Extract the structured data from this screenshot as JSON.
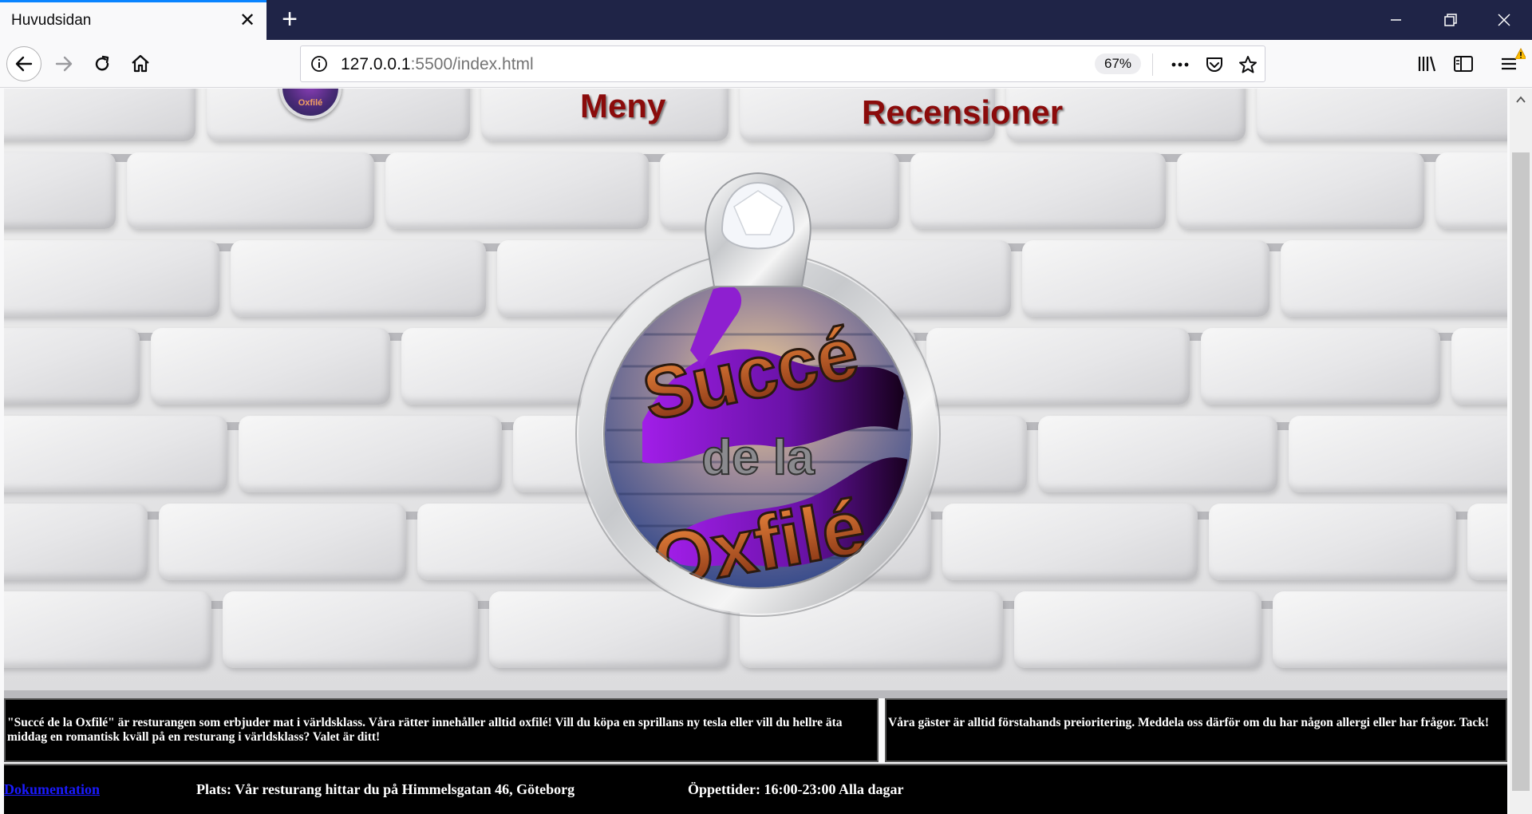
{
  "browser": {
    "tab_title": "Huvudsidan",
    "url_host": "127.0.0.1",
    "url_rest": ":5500/index.html",
    "zoom": "67%"
  },
  "site": {
    "logo_small_text": "Oxfilé",
    "nav": {
      "meny": "Meny",
      "recensioner": "Recensioner"
    },
    "logo_main": {
      "line1": "Succé",
      "line2": "de la",
      "line3": "Oxfilé"
    },
    "info_left": "\"Succé de la Oxfilé\" är resturangen som erbjuder mat i världsklass. Våra rätter innehåller alltid oxfilé! Vill du köpa en sprillans ny tesla eller vill du hellre äta middag en romantisk kväll på en resturang i världsklass? Valet är ditt!",
    "info_right": "Våra gäster är alltid förstahands preioritering. Meddela oss därför om du har någon allergi eller har frågor. Tack!",
    "footer": {
      "doc_link": "Dokumentation",
      "plats": "Plats: Vår resturang hittar du på Himmelsgatan 46, Göteborg",
      "tider": "Öppettider: 16:00-23:00 Alla dagar"
    }
  },
  "colors": {
    "tabstrip": "#1f2447",
    "nav_text": "#8b0b0b",
    "purple": "#8e1fd0",
    "orange": "#c4561a"
  }
}
